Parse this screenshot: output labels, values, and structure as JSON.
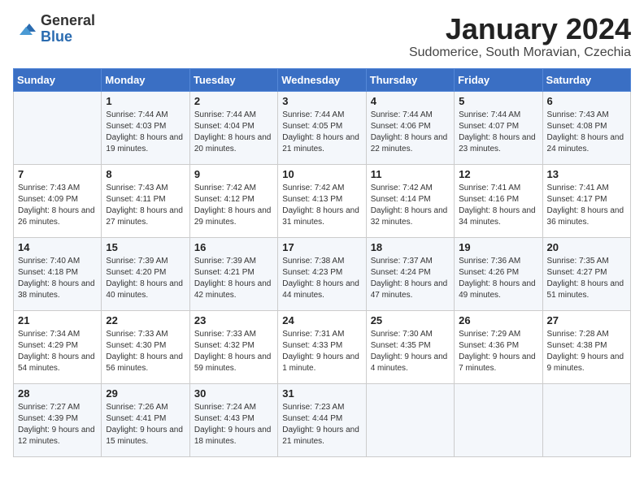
{
  "header": {
    "logo_general": "General",
    "logo_blue": "Blue",
    "title": "January 2024",
    "subtitle": "Sudomerice, South Moravian, Czechia"
  },
  "weekdays": [
    "Sunday",
    "Monday",
    "Tuesday",
    "Wednesday",
    "Thursday",
    "Friday",
    "Saturday"
  ],
  "weeks": [
    [
      {
        "day": "",
        "sunrise": "",
        "sunset": "",
        "daylight": ""
      },
      {
        "day": "1",
        "sunrise": "Sunrise: 7:44 AM",
        "sunset": "Sunset: 4:03 PM",
        "daylight": "Daylight: 8 hours and 19 minutes."
      },
      {
        "day": "2",
        "sunrise": "Sunrise: 7:44 AM",
        "sunset": "Sunset: 4:04 PM",
        "daylight": "Daylight: 8 hours and 20 minutes."
      },
      {
        "day": "3",
        "sunrise": "Sunrise: 7:44 AM",
        "sunset": "Sunset: 4:05 PM",
        "daylight": "Daylight: 8 hours and 21 minutes."
      },
      {
        "day": "4",
        "sunrise": "Sunrise: 7:44 AM",
        "sunset": "Sunset: 4:06 PM",
        "daylight": "Daylight: 8 hours and 22 minutes."
      },
      {
        "day": "5",
        "sunrise": "Sunrise: 7:44 AM",
        "sunset": "Sunset: 4:07 PM",
        "daylight": "Daylight: 8 hours and 23 minutes."
      },
      {
        "day": "6",
        "sunrise": "Sunrise: 7:43 AM",
        "sunset": "Sunset: 4:08 PM",
        "daylight": "Daylight: 8 hours and 24 minutes."
      }
    ],
    [
      {
        "day": "7",
        "sunrise": "Sunrise: 7:43 AM",
        "sunset": "Sunset: 4:09 PM",
        "daylight": "Daylight: 8 hours and 26 minutes."
      },
      {
        "day": "8",
        "sunrise": "Sunrise: 7:43 AM",
        "sunset": "Sunset: 4:11 PM",
        "daylight": "Daylight: 8 hours and 27 minutes."
      },
      {
        "day": "9",
        "sunrise": "Sunrise: 7:42 AM",
        "sunset": "Sunset: 4:12 PM",
        "daylight": "Daylight: 8 hours and 29 minutes."
      },
      {
        "day": "10",
        "sunrise": "Sunrise: 7:42 AM",
        "sunset": "Sunset: 4:13 PM",
        "daylight": "Daylight: 8 hours and 31 minutes."
      },
      {
        "day": "11",
        "sunrise": "Sunrise: 7:42 AM",
        "sunset": "Sunset: 4:14 PM",
        "daylight": "Daylight: 8 hours and 32 minutes."
      },
      {
        "day": "12",
        "sunrise": "Sunrise: 7:41 AM",
        "sunset": "Sunset: 4:16 PM",
        "daylight": "Daylight: 8 hours and 34 minutes."
      },
      {
        "day": "13",
        "sunrise": "Sunrise: 7:41 AM",
        "sunset": "Sunset: 4:17 PM",
        "daylight": "Daylight: 8 hours and 36 minutes."
      }
    ],
    [
      {
        "day": "14",
        "sunrise": "Sunrise: 7:40 AM",
        "sunset": "Sunset: 4:18 PM",
        "daylight": "Daylight: 8 hours and 38 minutes."
      },
      {
        "day": "15",
        "sunrise": "Sunrise: 7:39 AM",
        "sunset": "Sunset: 4:20 PM",
        "daylight": "Daylight: 8 hours and 40 minutes."
      },
      {
        "day": "16",
        "sunrise": "Sunrise: 7:39 AM",
        "sunset": "Sunset: 4:21 PM",
        "daylight": "Daylight: 8 hours and 42 minutes."
      },
      {
        "day": "17",
        "sunrise": "Sunrise: 7:38 AM",
        "sunset": "Sunset: 4:23 PM",
        "daylight": "Daylight: 8 hours and 44 minutes."
      },
      {
        "day": "18",
        "sunrise": "Sunrise: 7:37 AM",
        "sunset": "Sunset: 4:24 PM",
        "daylight": "Daylight: 8 hours and 47 minutes."
      },
      {
        "day": "19",
        "sunrise": "Sunrise: 7:36 AM",
        "sunset": "Sunset: 4:26 PM",
        "daylight": "Daylight: 8 hours and 49 minutes."
      },
      {
        "day": "20",
        "sunrise": "Sunrise: 7:35 AM",
        "sunset": "Sunset: 4:27 PM",
        "daylight": "Daylight: 8 hours and 51 minutes."
      }
    ],
    [
      {
        "day": "21",
        "sunrise": "Sunrise: 7:34 AM",
        "sunset": "Sunset: 4:29 PM",
        "daylight": "Daylight: 8 hours and 54 minutes."
      },
      {
        "day": "22",
        "sunrise": "Sunrise: 7:33 AM",
        "sunset": "Sunset: 4:30 PM",
        "daylight": "Daylight: 8 hours and 56 minutes."
      },
      {
        "day": "23",
        "sunrise": "Sunrise: 7:33 AM",
        "sunset": "Sunset: 4:32 PM",
        "daylight": "Daylight: 8 hours and 59 minutes."
      },
      {
        "day": "24",
        "sunrise": "Sunrise: 7:31 AM",
        "sunset": "Sunset: 4:33 PM",
        "daylight": "Daylight: 9 hours and 1 minute."
      },
      {
        "day": "25",
        "sunrise": "Sunrise: 7:30 AM",
        "sunset": "Sunset: 4:35 PM",
        "daylight": "Daylight: 9 hours and 4 minutes."
      },
      {
        "day": "26",
        "sunrise": "Sunrise: 7:29 AM",
        "sunset": "Sunset: 4:36 PM",
        "daylight": "Daylight: 9 hours and 7 minutes."
      },
      {
        "day": "27",
        "sunrise": "Sunrise: 7:28 AM",
        "sunset": "Sunset: 4:38 PM",
        "daylight": "Daylight: 9 hours and 9 minutes."
      }
    ],
    [
      {
        "day": "28",
        "sunrise": "Sunrise: 7:27 AM",
        "sunset": "Sunset: 4:39 PM",
        "daylight": "Daylight: 9 hours and 12 minutes."
      },
      {
        "day": "29",
        "sunrise": "Sunrise: 7:26 AM",
        "sunset": "Sunset: 4:41 PM",
        "daylight": "Daylight: 9 hours and 15 minutes."
      },
      {
        "day": "30",
        "sunrise": "Sunrise: 7:24 AM",
        "sunset": "Sunset: 4:43 PM",
        "daylight": "Daylight: 9 hours and 18 minutes."
      },
      {
        "day": "31",
        "sunrise": "Sunrise: 7:23 AM",
        "sunset": "Sunset: 4:44 PM",
        "daylight": "Daylight: 9 hours and 21 minutes."
      },
      {
        "day": "",
        "sunrise": "",
        "sunset": "",
        "daylight": ""
      },
      {
        "day": "",
        "sunrise": "",
        "sunset": "",
        "daylight": ""
      },
      {
        "day": "",
        "sunrise": "",
        "sunset": "",
        "daylight": ""
      }
    ]
  ]
}
